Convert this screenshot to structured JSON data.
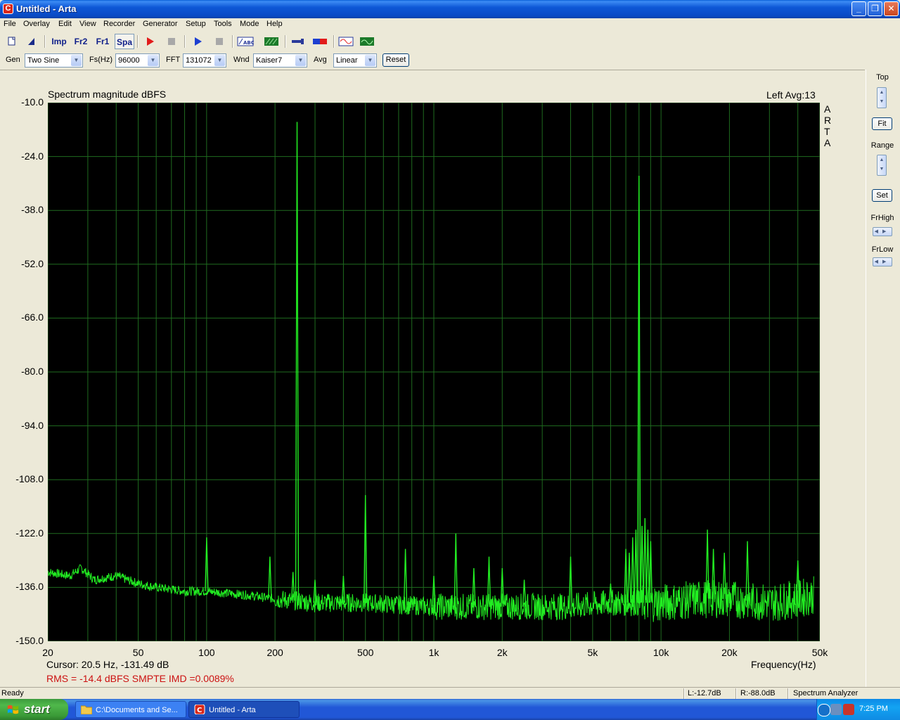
{
  "window": {
    "title": "Untitled - Arta",
    "icon": "arta-app-icon",
    "controls": {
      "minimize": "_",
      "maximize": "❐",
      "close": "✕"
    }
  },
  "menu": [
    "File",
    "Overlay",
    "Edit",
    "View",
    "Recorder",
    "Generator",
    "Setup",
    "Tools",
    "Mode",
    "Help"
  ],
  "toolbar": {
    "imp": "Imp",
    "fr2": "Fr2",
    "fr1": "Fr1",
    "spa": "Spa",
    "icons": [
      "new-file-icon",
      "open-icon",
      "record-icon",
      "stop-icon",
      "play-icon",
      "stop-icon",
      "abc-icon",
      "waterfall-icon",
      "pin-icon",
      "level-bar-icon",
      "oscilloscope-icon",
      "spectrum-icon"
    ]
  },
  "controls": {
    "gen_label": "Gen",
    "gen_value": "Two Sine",
    "fs_label": "Fs(Hz)",
    "fs_value": "96000",
    "fft_label": "FFT",
    "fft_value": "131072",
    "wnd_label": "Wnd",
    "wnd_value": "Kaiser7",
    "avg_label": "Avg",
    "avg_value": "Linear",
    "reset_label": "Reset"
  },
  "side": {
    "top": "Top",
    "fit": "Fit",
    "range": "Range",
    "set": "Set",
    "frhigh": "FrHigh",
    "frlow": "FrLow"
  },
  "plot": {
    "title": "Spectrum magnitude dBFS",
    "right_title": "Left  Avg:13",
    "brand": [
      "A",
      "R",
      "T",
      "A"
    ],
    "cursor": "Cursor:    20.5 Hz, -131.49 dB",
    "xlabel": "Frequency(Hz)",
    "rms": "RMS =  -14.4 dBFS   SMPTE IMD =0.0089%"
  },
  "chart_data": {
    "type": "line",
    "title": "Spectrum magnitude dBFS",
    "xlabel": "Frequency(Hz)",
    "ylabel": "",
    "xscale": "log",
    "xlim": [
      20,
      50000
    ],
    "ylim": [
      -150,
      -10
    ],
    "grid": true,
    "trace_color": "#22ee22",
    "grid_color": "#1f6b1f",
    "y_ticks": [
      "-10.0",
      "-24.0",
      "-38.0",
      "-52.0",
      "-66.0",
      "-80.0",
      "-94.0",
      "-108.0",
      "-122.0",
      "-136.0",
      "-150.0"
    ],
    "x_ticks": [
      {
        "label": "20",
        "value": 20
      },
      {
        "label": "50",
        "value": 50
      },
      {
        "label": "100",
        "value": 100
      },
      {
        "label": "200",
        "value": 200
      },
      {
        "label": "500",
        "value": 500
      },
      {
        "label": "1k",
        "value": 1000
      },
      {
        "label": "2k",
        "value": 2000
      },
      {
        "label": "5k",
        "value": 5000
      },
      {
        "label": "10k",
        "value": 10000
      },
      {
        "label": "20k",
        "value": 20000
      },
      {
        "label": "50k",
        "value": 50000
      }
    ],
    "noise_floor": [
      [
        20,
        -132
      ],
      [
        25,
        -133
      ],
      [
        28,
        -131
      ],
      [
        32,
        -134
      ],
      [
        40,
        -133
      ],
      [
        50,
        -135
      ],
      [
        60,
        -136
      ],
      [
        80,
        -137
      ],
      [
        100,
        -137
      ],
      [
        150,
        -138
      ],
      [
        200,
        -139
      ],
      [
        300,
        -140
      ],
      [
        500,
        -140
      ],
      [
        1000,
        -141
      ],
      [
        2000,
        -141
      ],
      [
        4000,
        -141
      ],
      [
        6000,
        -140
      ],
      [
        8000,
        -140
      ],
      [
        10000,
        -140
      ],
      [
        15000,
        -139
      ],
      [
        20000,
        -139
      ],
      [
        30000,
        -140
      ],
      [
        40000,
        -139
      ],
      [
        47000,
        -138
      ]
    ],
    "peaks": [
      {
        "f": 100,
        "db": -123
      },
      {
        "f": 190,
        "db": -128
      },
      {
        "f": 240,
        "db": -132
      },
      {
        "f": 250,
        "db": -15
      },
      {
        "f": 300,
        "db": -134
      },
      {
        "f": 400,
        "db": -133
      },
      {
        "f": 500,
        "db": -112
      },
      {
        "f": 750,
        "db": -126
      },
      {
        "f": 1000,
        "db": -133
      },
      {
        "f": 1250,
        "db": -122
      },
      {
        "f": 1500,
        "db": -131
      },
      {
        "f": 1750,
        "db": -128
      },
      {
        "f": 2000,
        "db": -131
      },
      {
        "f": 2500,
        "db": -134
      },
      {
        "f": 4000,
        "db": -128
      },
      {
        "f": 6000,
        "db": -135
      },
      {
        "f": 7000,
        "db": -126
      },
      {
        "f": 7250,
        "db": -127
      },
      {
        "f": 7500,
        "db": -123
      },
      {
        "f": 7750,
        "db": -121
      },
      {
        "f": 8000,
        "db": -29
      },
      {
        "f": 8250,
        "db": -120
      },
      {
        "f": 8500,
        "db": -118
      },
      {
        "f": 8750,
        "db": -121
      },
      {
        "f": 9000,
        "db": -124
      },
      {
        "f": 16000,
        "db": -121
      },
      {
        "f": 17000,
        "db": -126
      },
      {
        "f": 19000,
        "db": -127
      },
      {
        "f": 24000,
        "db": -124
      },
      {
        "f": 40000,
        "db": -129
      }
    ]
  },
  "status": {
    "ready": "Ready",
    "left": "L:-12.7dB",
    "right": "R:-88.0dB",
    "mode": "Spectrum Analyzer"
  },
  "taskbar": {
    "start": "start",
    "items": [
      {
        "label": "C:\\Documents and Se...",
        "icon": "folder-icon"
      },
      {
        "label": "Untitled - Arta",
        "icon": "arta-app-icon"
      }
    ],
    "clock": "7:25 PM"
  }
}
